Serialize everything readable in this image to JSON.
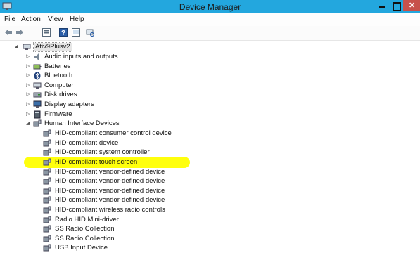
{
  "window": {
    "title": "Device Manager"
  },
  "menu": [
    "File",
    "Action",
    "View",
    "Help"
  ],
  "toolbar": {
    "icons": [
      "back-icon",
      "forward-icon",
      "properties-icon",
      "help-icon",
      "scan-hardware-icon"
    ]
  },
  "tree": {
    "root": "Ativ9Plusv2",
    "categories": [
      "Audio inputs and outputs",
      "Batteries",
      "Bluetooth",
      "Computer",
      "Disk drives",
      "Display adapters",
      "Firmware",
      "Human Interface Devices"
    ],
    "hid_devices": [
      "HID-compliant consumer control device",
      "HID-compliant device",
      "HID-compliant system controller",
      "HID-compliant touch screen",
      "HID-compliant vendor-defined device",
      "HID-compliant vendor-defined device",
      "HID-compliant vendor-defined device",
      "HID-compliant vendor-defined device",
      "HID-compliant wireless radio controls",
      "Radio HID Mini-driver",
      "SS Radio Collection",
      "SS Radio Collection",
      "USB Input Device"
    ],
    "highlighted_device": "HID-compliant touch screen"
  },
  "colors": {
    "titlebar": "#23a7de",
    "highlight": "#ffff00",
    "close": "#c7514b"
  }
}
